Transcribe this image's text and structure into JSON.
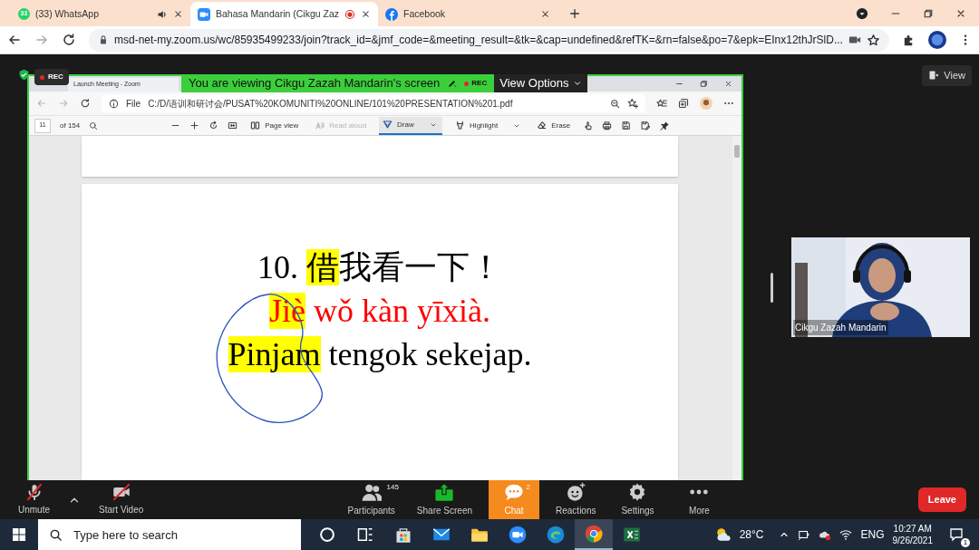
{
  "browser": {
    "tabs": [
      {
        "kind": "whatsapp",
        "icon_text": "33",
        "title": "(33) WhatsApp",
        "playing_audio": true,
        "recording": false,
        "selected": false
      },
      {
        "kind": "zoom",
        "title": "Bahasa Mandarin (Cikgu Zaz",
        "playing_audio": false,
        "recording": true,
        "selected": true
      },
      {
        "kind": "facebook",
        "title": "Facebook",
        "playing_audio": false,
        "recording": false,
        "selected": false
      }
    ],
    "url": "msd-net-my.zoom.us/wc/85935499233/join?track_id=&jmf_code=&meeting_result=&tk=&cap=undefined&refTK=&rn=false&po=7&epk=EInx12thJrSlD..."
  },
  "zoom": {
    "rec_label": "REC",
    "banner": {
      "text": "You are viewing Cikgu Zazah Mandarin's screen",
      "rec_label": "REC",
      "options": "View Options"
    },
    "view_button": "View",
    "shared_window": {
      "tab_title": "Launch Meeting - Zoom",
      "file_label": "File",
      "path": "C:/D/语训和研讨会/PUSAT%20KOMUNITI%20ONLINE/101%20PRESENTATION%201.pdf",
      "page": "11",
      "page_count": "of 154",
      "tools": [
        {
          "kind": "page_view",
          "label": "Page view",
          "disabled": false,
          "selected": false
        },
        {
          "kind": "read_aloud",
          "label": "Read aloud",
          "disabled": true,
          "selected": false
        },
        {
          "kind": "draw",
          "label": "Draw",
          "disabled": false,
          "selected": true
        },
        {
          "kind": "highlight",
          "label": "Highlight",
          "disabled": false,
          "selected": false
        },
        {
          "kind": "erase",
          "label": "Erase",
          "disabled": false,
          "selected": false
        }
      ],
      "slide": {
        "lines": [
          {
            "color": "#000000",
            "segments": [
              {
                "text": "10. ",
                "highlighted": false
              },
              {
                "text": "借",
                "highlighted": true
              },
              {
                "text": "我看一下！",
                "highlighted": false
              }
            ]
          },
          {
            "color": "#ff0000",
            "segments": [
              {
                "text": "Jiè",
                "highlighted": true
              },
              {
                "text": " wǒ kàn yīxià.",
                "highlighted": false
              }
            ]
          },
          {
            "color": "#000000",
            "segments": [
              {
                "text": "Pinjam",
                "highlighted": true
              },
              {
                "text": " tengok sekejap.",
                "highlighted": false
              }
            ]
          }
        ]
      }
    },
    "video": {
      "name": "Cikgu Zazah Mandarin"
    },
    "audio": {
      "label": "Unmute",
      "on": false
    },
    "camera": {
      "label": "Start Video",
      "on": false
    },
    "controls": [
      {
        "kind": "participants",
        "label": "Participants",
        "badge": "145",
        "selected": false
      },
      {
        "kind": "share",
        "label": "Share Screen",
        "selected": false
      },
      {
        "kind": "chat",
        "label": "Chat",
        "badge": "2",
        "selected": true
      },
      {
        "kind": "reactions",
        "label": "Reactions",
        "selected": false
      },
      {
        "kind": "settings",
        "label": "Settings",
        "selected": false
      },
      {
        "kind": "more",
        "label": "More",
        "selected": false
      }
    ],
    "leave": "Leave"
  },
  "taskbar": {
    "search_placeholder": "Type here to search",
    "apps": [
      {
        "kind": "cortana",
        "selected": false
      },
      {
        "kind": "taskview",
        "selected": false
      },
      {
        "kind": "store",
        "selected": false
      },
      {
        "kind": "mail",
        "selected": false
      },
      {
        "kind": "explorer",
        "selected": false
      },
      {
        "kind": "zoom",
        "selected": false
      },
      {
        "kind": "edge",
        "selected": false
      },
      {
        "kind": "chrome",
        "selected": true
      },
      {
        "kind": "excel",
        "selected": false
      }
    ],
    "weather": "28°C",
    "language": "ENG",
    "time": "10:27 AM",
    "date": "9/26/2021",
    "notifications": "1"
  }
}
